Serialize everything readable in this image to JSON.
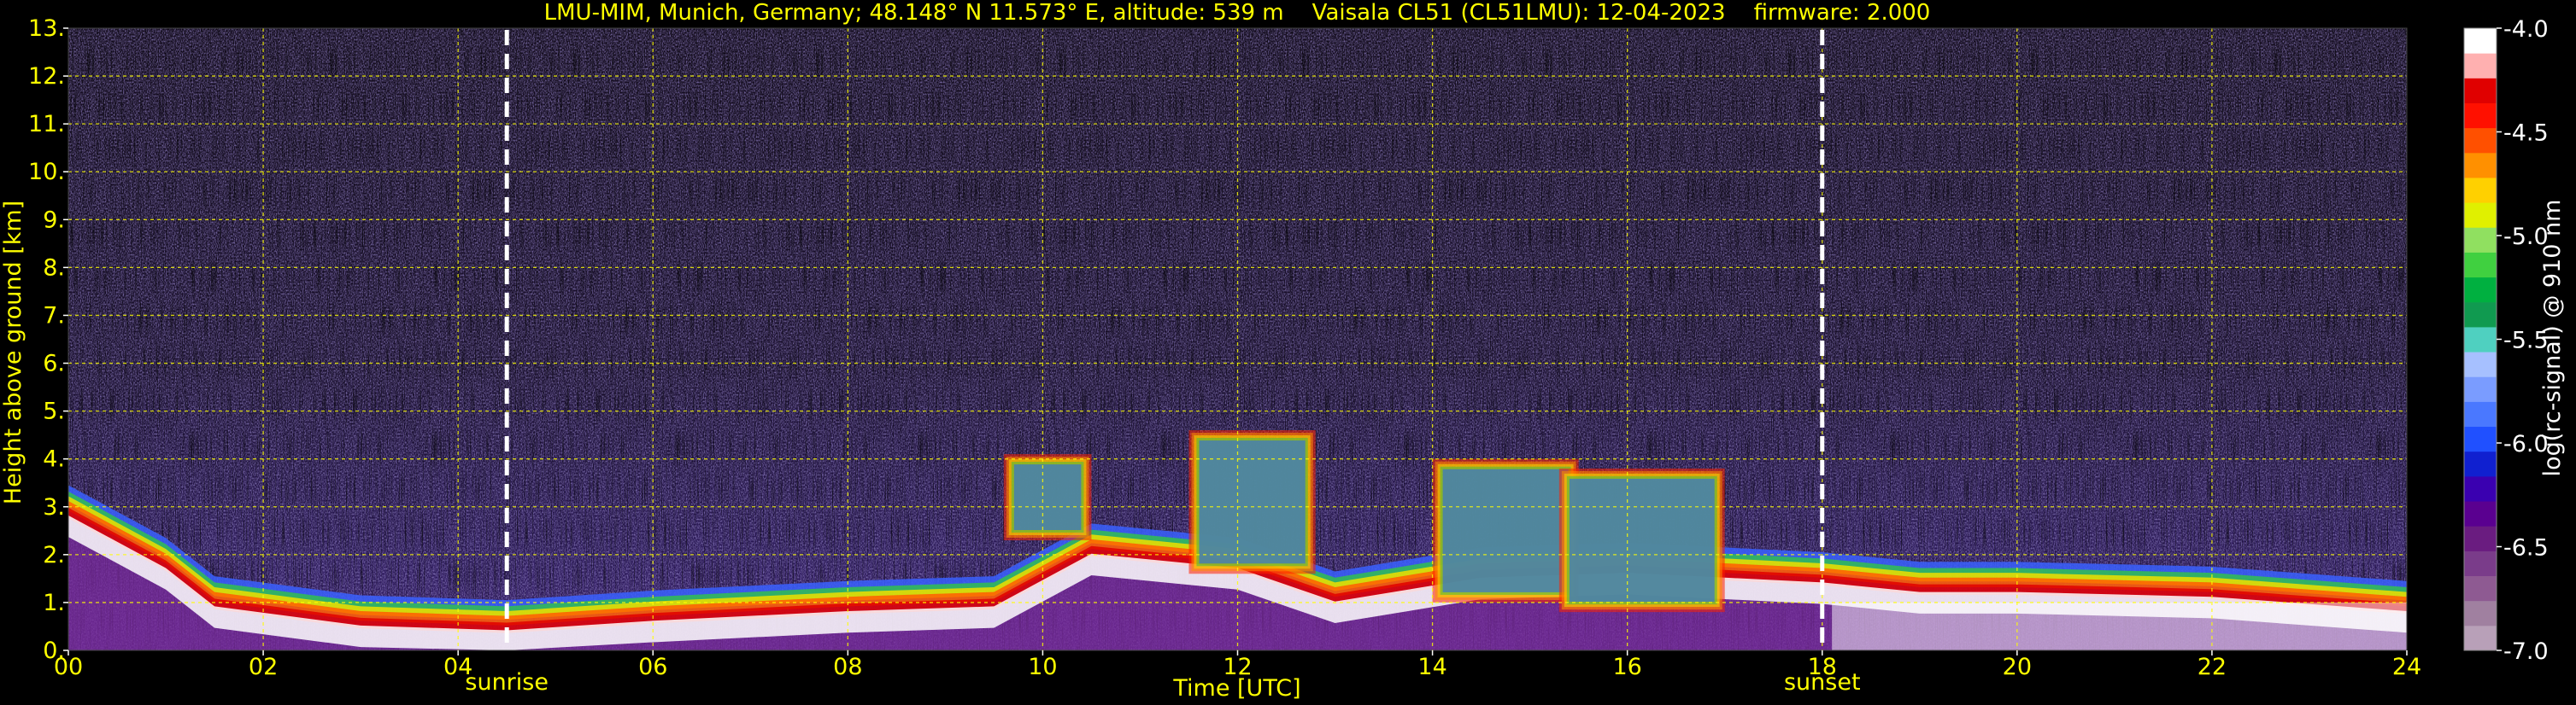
{
  "chart_data": {
    "type": "heatmap",
    "title": "LMU-MIM, Munich, Germany; 48.148° N 11.573° E, altitude: 539 m    Vaisala CL51 (CL51LMU): 12-04-2023    firmware: 2.000",
    "xlabel": "Time [UTC]",
    "ylabel": "Height above ground [km]",
    "xlim": [
      0,
      24
    ],
    "ylim": [
      0,
      13
    ],
    "x_ticks": [
      "00",
      "02",
      "04",
      "06",
      "08",
      "10",
      "12",
      "14",
      "16",
      "18",
      "20",
      "22",
      "24"
    ],
    "y_ticks": [
      "0.",
      "1.",
      "2.",
      "3.",
      "4.",
      "5.",
      "6.",
      "7.",
      "8.",
      "9.",
      "10.",
      "11.",
      "12.",
      "13."
    ],
    "grid": true,
    "grid_color": "#ffff00",
    "events": [
      {
        "label": "sunrise",
        "time": 4.5
      },
      {
        "label": "sunset",
        "time": 18.0
      }
    ],
    "colorbar": {
      "label": "log(rc-signal) @ 910 nm",
      "range": [
        -7.0,
        -4.0
      ],
      "ticks": [
        "-4.0",
        "-4.5",
        "-5.0",
        "-5.5",
        "-6.0",
        "-6.5",
        "-7.0"
      ],
      "colors": [
        "#b8a0b8",
        "#a080a0",
        "#8e5a92",
        "#7a3c8a",
        "#6a1c80",
        "#5a0090",
        "#3a00b0",
        "#1020d0",
        "#2050ff",
        "#4a78ff",
        "#7a9cff",
        "#a6c0ff",
        "#4fd0c0",
        "#109a50",
        "#00b040",
        "#40d040",
        "#90e060",
        "#e0f000",
        "#ffd000",
        "#ff9000",
        "#ff5000",
        "#ff1000",
        "#e00000",
        "#ffb0b0",
        "#ffffff"
      ]
    },
    "features": {
      "boundary_layer_top_km": [
        [
          0,
          3.1
        ],
        [
          1,
          2.0
        ],
        [
          1.5,
          1.2
        ],
        [
          3,
          0.8
        ],
        [
          4.5,
          0.7
        ],
        [
          6,
          0.9
        ],
        [
          8,
          1.1
        ],
        [
          9.5,
          1.2
        ],
        [
          10.5,
          2.3
        ],
        [
          12,
          2.0
        ],
        [
          13,
          1.3
        ],
        [
          14.5,
          1.8
        ],
        [
          16,
          1.9
        ],
        [
          17,
          1.8
        ],
        [
          18,
          1.7
        ],
        [
          19,
          1.5
        ],
        [
          20,
          1.5
        ],
        [
          22,
          1.4
        ],
        [
          24,
          1.1
        ]
      ],
      "cloud_layers": [
        {
          "t_start": 9.6,
          "t_end": 10.5,
          "base_km": 2.3,
          "top_km": 4.1
        },
        {
          "t_start": 11.5,
          "t_end": 12.8,
          "base_km": 1.6,
          "top_km": 4.6
        },
        {
          "t_start": 14.0,
          "t_end": 15.5,
          "base_km": 1.0,
          "top_km": 4.0
        },
        {
          "t_start": 15.3,
          "t_end": 17.0,
          "base_km": 0.8,
          "top_km": 3.8
        }
      ]
    }
  }
}
